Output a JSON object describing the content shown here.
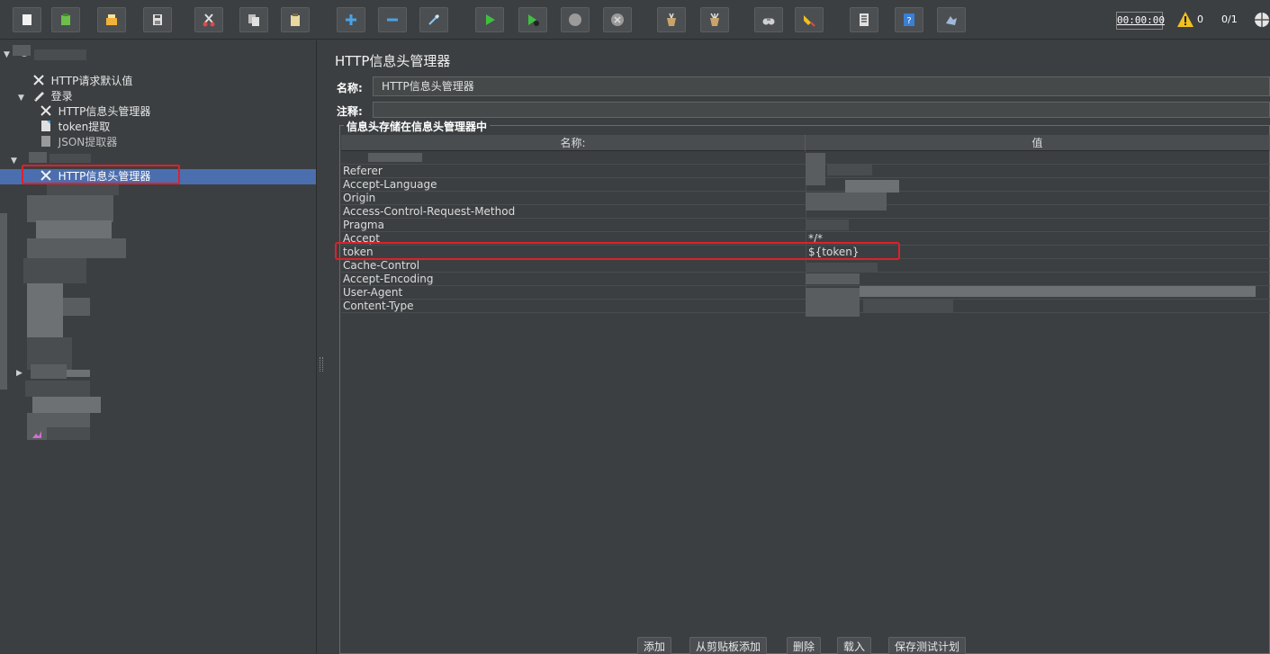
{
  "toolbar": {
    "buttons": [
      {
        "icon": "new-icon",
        "color": "#f2f2f2"
      },
      {
        "icon": "templates-icon",
        "color": "#6cbf4a"
      },
      {
        "icon": "open-icon",
        "color": "#f0b23a"
      },
      {
        "icon": "save-icon",
        "color": "#e0e0e0"
      },
      {
        "icon": "cut-icon",
        "color": "#e04848"
      },
      {
        "icon": "copy-icon",
        "color": "#e0e0e0"
      },
      {
        "icon": "paste-icon",
        "color": "#e8d9a0"
      },
      {
        "icon": "expand-icon",
        "color": "#4aa3e6"
      },
      {
        "icon": "collapse-icon",
        "color": "#4aa3e6"
      },
      {
        "icon": "toggle-icon",
        "color": "#8fc4ea"
      },
      {
        "icon": "start-icon",
        "color": "#3fbf3f"
      },
      {
        "icon": "start-no-pause-icon",
        "color": "#3fbf3f"
      },
      {
        "icon": "stop-icon",
        "color": "#9a9a9a"
      },
      {
        "icon": "shutdown-icon",
        "color": "#9a9a9a"
      },
      {
        "icon": "clear-icon",
        "color": "#c9a46a"
      },
      {
        "icon": "clear-all-icon",
        "color": "#c9a46a"
      },
      {
        "icon": "search-icon",
        "color": "#cfcfcf"
      },
      {
        "icon": "reset-search-icon",
        "color": "#f0c020"
      },
      {
        "icon": "function-helper-icon",
        "color": "#e0e0e0"
      },
      {
        "icon": "help-icon",
        "color": "#3a7fd6"
      },
      {
        "icon": "remote-icon",
        "color": "#a0b8d8"
      }
    ],
    "timer": "00:00:00",
    "warning_count": "0",
    "threads": "0/1"
  },
  "tree": {
    "items": [
      {
        "label": "HTTP请求默认值",
        "icon": "wrench-icon"
      },
      {
        "label": "登录",
        "icon": "pencil-icon"
      },
      {
        "label": "HTTP信息头管理器",
        "icon": "wrench-icon"
      },
      {
        "label": "token提取",
        "icon": "document-icon"
      },
      {
        "label": "JSON提取器",
        "icon": "document-icon"
      },
      {
        "label": "HTTP信息头管理器",
        "icon": "wrench-icon",
        "selected": true
      }
    ]
  },
  "panel": {
    "title": "HTTP信息头管理器",
    "name_label": "名称:",
    "name_value": "HTTP信息头管理器",
    "comment_label": "注释:",
    "group_title": "信息头存储在信息头管理器中",
    "columns": [
      "名称:",
      "值"
    ],
    "rows": [
      {
        "name": "Referer",
        "value": ""
      },
      {
        "name": "Accept-Language",
        "value": ""
      },
      {
        "name": "Origin",
        "value": ""
      },
      {
        "name": "Access-Control-Request-Method",
        "value": ""
      },
      {
        "name": "Pragma",
        "value": ""
      },
      {
        "name": "Accept",
        "value": "*/*"
      },
      {
        "name": "token",
        "value": "${token}"
      },
      {
        "name": "Cache-Control",
        "value": ""
      },
      {
        "name": "Accept-Encoding",
        "value": ""
      },
      {
        "name": "User-Agent",
        "value": ""
      },
      {
        "name": "Content-Type",
        "value": ""
      }
    ]
  },
  "footer": {
    "add": "添加",
    "add_clipboard": "从剪贴板添加",
    "delete": "删除",
    "load": "载入",
    "save": "保存测试计划"
  },
  "colors": {
    "background": "#3c3f41",
    "selection": "#4b6eaf",
    "highlight_box": "#e0202a"
  }
}
